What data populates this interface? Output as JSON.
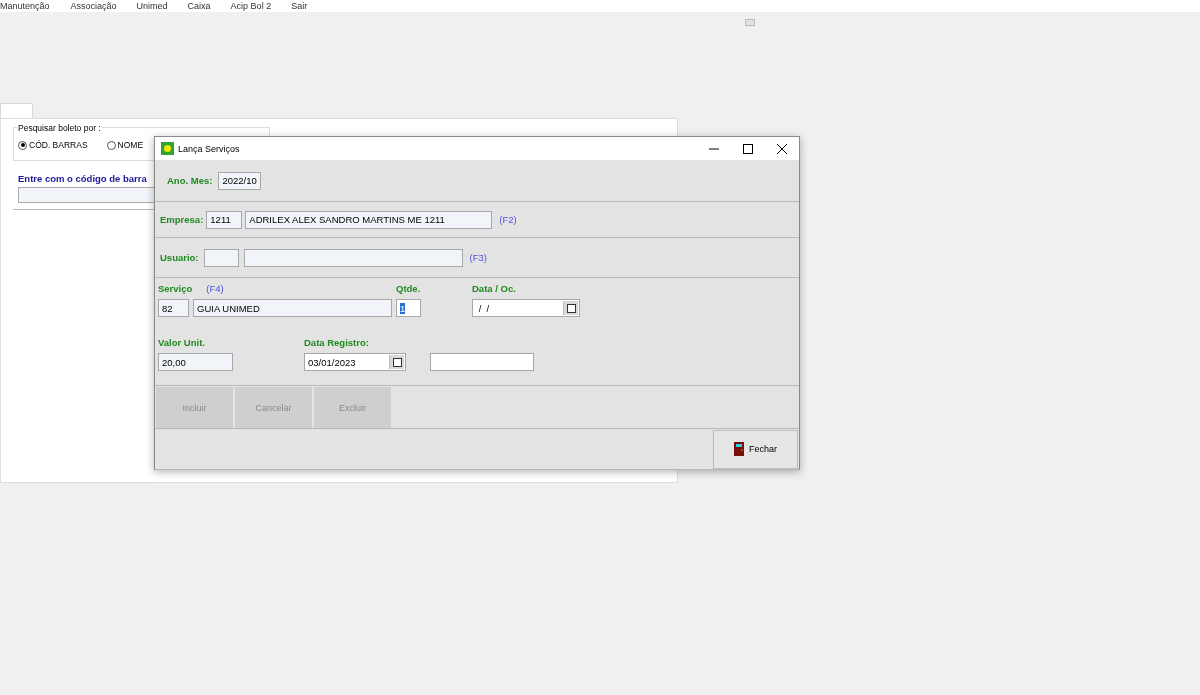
{
  "menu": [
    "Manutenção",
    "Associação",
    "Unimed",
    "Caixa",
    "Acip Bol 2",
    "Sair"
  ],
  "background_window": {
    "search_group": {
      "title": "Pesquisar boleto por :",
      "options": [
        {
          "label": "CÓD. BARRAS",
          "selected": true
        },
        {
          "label": "NOME",
          "selected": false
        }
      ]
    },
    "barcode_label": "Entre com o código de barra"
  },
  "dialog": {
    "title": "Lança Serviços",
    "ano_mes": {
      "label": "Ano. Mes:",
      "value": "2022/10"
    },
    "empresa": {
      "label": "Empresa:",
      "code": "1211",
      "name": "ADRILEX ALEX SANDRO MARTINS ME 1211",
      "hotkey": "(F2)"
    },
    "usuario": {
      "label": "Usuario:",
      "hotkey": "(F3)"
    },
    "servico": {
      "label": "Serviço",
      "hotkey": "(F4)",
      "code": "82",
      "name": "GUIA UNIMED"
    },
    "qtde": {
      "label": "Qtde.",
      "value": "1",
      "text_selected": true
    },
    "data_oc": {
      "label": "Data / Oc.",
      "value": " /  /"
    },
    "valor_unit": {
      "label": "Valor Unit.",
      "value": "20,00"
    },
    "data_registro": {
      "label": "Data Registro:",
      "value": "03/01/2023"
    },
    "actions": [
      {
        "label": "Incluir",
        "disabled": true
      },
      {
        "label": "Cancelar",
        "disabled": true
      },
      {
        "label": "Excluir",
        "disabled": true
      }
    ],
    "close_button": {
      "label": "Fechar",
      "disabled": false
    }
  }
}
